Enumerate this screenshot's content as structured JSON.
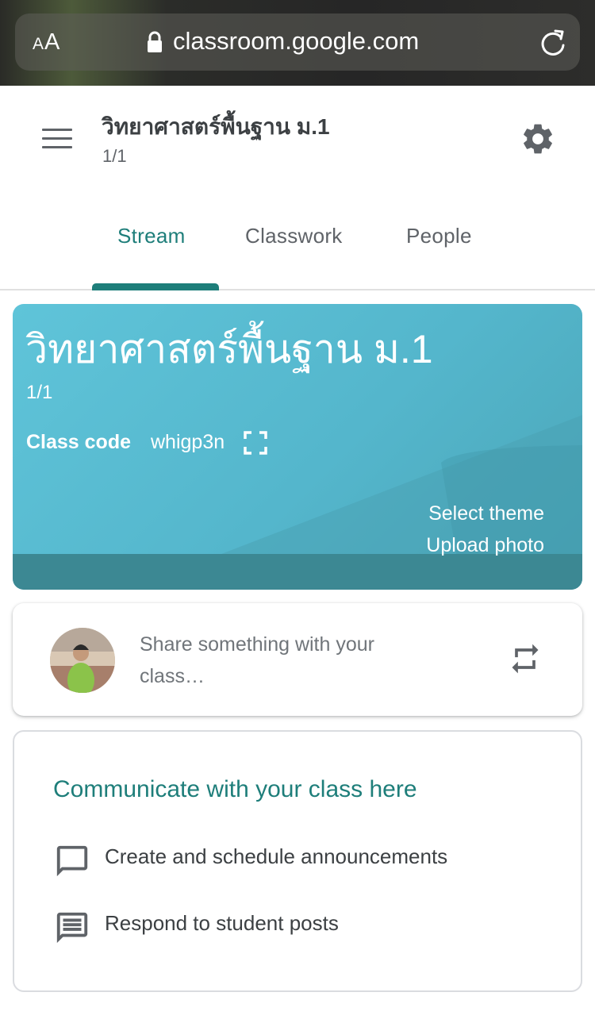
{
  "browser": {
    "text_size_label_small": "A",
    "text_size_label_large": "A",
    "url": "classroom.google.com",
    "icons": [
      "lock-icon",
      "reload-icon"
    ]
  },
  "header": {
    "title": "วิทยาศาสตร์พื้นฐาน ม.1",
    "subtitle": "1/1",
    "icons": [
      "menu-icon",
      "gear-icon"
    ]
  },
  "tabs": [
    {
      "label": "Stream",
      "active": true
    },
    {
      "label": "Classwork",
      "active": false
    },
    {
      "label": "People",
      "active": false
    }
  ],
  "banner": {
    "title": "วิทยาศาสตร์พื้นฐาน ม.1",
    "section": "1/1",
    "class_code_label": "Class code",
    "class_code": "whigp3n",
    "select_theme": "Select theme",
    "upload_photo": "Upload photo",
    "color": "#5fc4d9"
  },
  "share": {
    "placeholder": "Share something with your class…",
    "icons": [
      "avatar",
      "repost-icon"
    ]
  },
  "communicate": {
    "title": "Communicate with your class here",
    "items": [
      {
        "icon": "comment-icon",
        "label": "Create and schedule announcements"
      },
      {
        "icon": "chat-lines-icon",
        "label": "Respond to student posts"
      }
    ]
  },
  "colors": {
    "accent": "#1e7e7a",
    "text": "#3c4043",
    "muted": "#5f6368"
  }
}
